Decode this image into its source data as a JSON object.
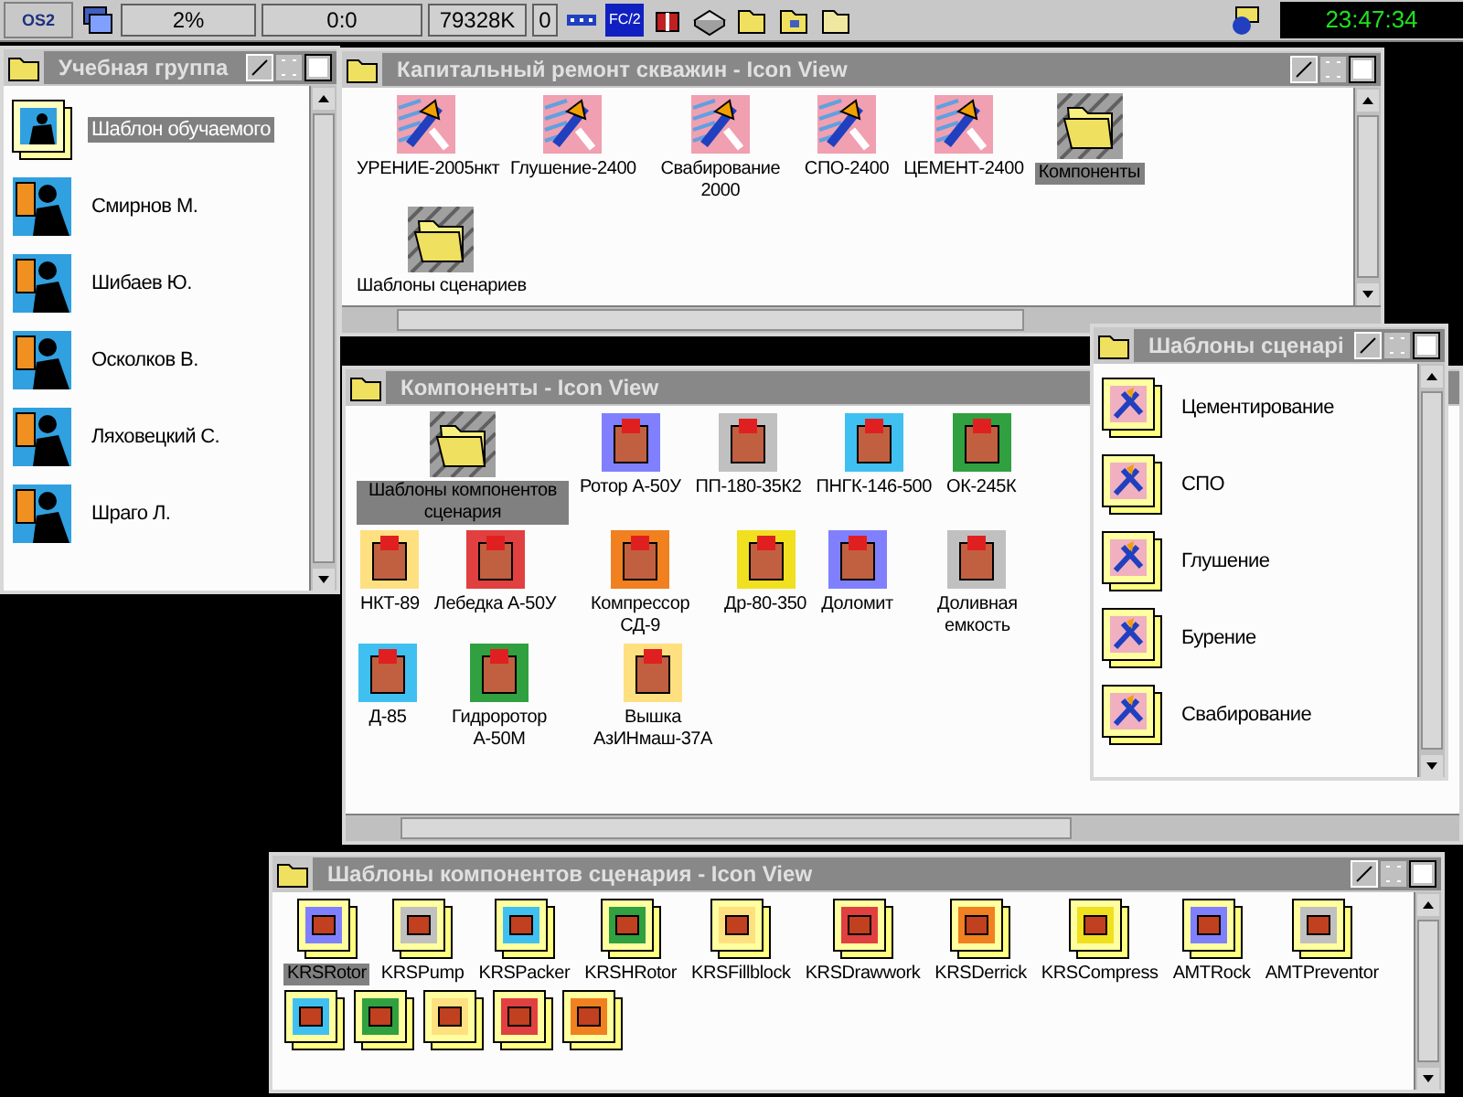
{
  "taskbar": {
    "logo": "OS2",
    "cpu": "2%",
    "uptime": "0:0",
    "memory": "79328K",
    "counter": "0",
    "fc_label": "FC/2",
    "clock": "23:47:34"
  },
  "windows": [
    {
      "title": "Учебная группа",
      "kind": "list",
      "items": [
        {
          "label": "Шаблон обучаемого",
          "selected": true,
          "kind": "person-template"
        },
        {
          "label": "Смирнов М.",
          "selected": false,
          "kind": "person"
        },
        {
          "label": "Шибаев Ю.",
          "selected": false,
          "kind": "person"
        },
        {
          "label": "Осколков В.",
          "selected": false,
          "kind": "person"
        },
        {
          "label": "Ляховецкий С.",
          "selected": false,
          "kind": "person"
        },
        {
          "label": "Шраго Л.",
          "selected": false,
          "kind": "person"
        }
      ]
    },
    {
      "title": "Капитальный ремонт скважин - Icon View",
      "kind": "icons",
      "items": [
        {
          "label": "УРЕНИЕ-2005нкт",
          "selected": false,
          "kind": "scenario"
        },
        {
          "label": "Глушение-2400",
          "selected": false,
          "kind": "scenario"
        },
        {
          "label": "Свабирование 2000",
          "selected": false,
          "kind": "scenario"
        },
        {
          "label": "СПО-2400",
          "selected": false,
          "kind": "scenario"
        },
        {
          "label": "ЦЕМЕНТ-2400",
          "selected": false,
          "kind": "scenario"
        },
        {
          "label": "Компоненты",
          "selected": true,
          "kind": "folder"
        },
        {
          "label": "Шаблоны сценариев",
          "selected": false,
          "kind": "folder"
        }
      ]
    },
    {
      "title": "Компоненты - Icon View",
      "kind": "icons",
      "items": [
        {
          "label": "Шаблоны компонентов сценария",
          "selected": true,
          "kind": "folder"
        },
        {
          "label": "Ротор А-50У",
          "selected": false,
          "kind": "component"
        },
        {
          "label": "ПП-180-35К2",
          "selected": false,
          "kind": "component"
        },
        {
          "label": "ПНГК-146-500",
          "selected": false,
          "kind": "component"
        },
        {
          "label": "ОК-245К",
          "selected": false,
          "kind": "component"
        },
        {
          "label": "НКТ-89",
          "selected": false,
          "kind": "component"
        },
        {
          "label": "Лебедка А-50У",
          "selected": false,
          "kind": "component"
        },
        {
          "label": "Компрессор СД-9",
          "selected": false,
          "kind": "component"
        },
        {
          "label": "Др-80-350",
          "selected": false,
          "kind": "component"
        },
        {
          "label": "Доломит",
          "selected": false,
          "kind": "component"
        },
        {
          "label": "Доливная емкость",
          "selected": false,
          "kind": "component"
        },
        {
          "label": "Д-85",
          "selected": false,
          "kind": "component"
        },
        {
          "label": "Гидроротор А-50М",
          "selected": false,
          "kind": "component"
        },
        {
          "label": "Вышка АзИНмаш-37А",
          "selected": false,
          "kind": "component"
        }
      ]
    },
    {
      "title": "Шаблоны сценарі",
      "kind": "list",
      "items": [
        {
          "label": "Цементирование",
          "selected": false,
          "kind": "scenario-template"
        },
        {
          "label": "СПО",
          "selected": false,
          "kind": "scenario-template"
        },
        {
          "label": "Глушение",
          "selected": false,
          "kind": "scenario-template"
        },
        {
          "label": "Бурение",
          "selected": false,
          "kind": "scenario-template"
        },
        {
          "label": "Свабирование",
          "selected": false,
          "kind": "scenario-template"
        }
      ]
    },
    {
      "title": "Шаблоны компонентов сценария - Icon View",
      "kind": "icons",
      "items": [
        {
          "label": "KRSRotor",
          "selected": true,
          "kind": "component-template"
        },
        {
          "label": "KRSPump",
          "selected": false,
          "kind": "component-template"
        },
        {
          "label": "KRSPacker",
          "selected": false,
          "kind": "component-template"
        },
        {
          "label": "KRSHRotor",
          "selected": false,
          "kind": "component-template"
        },
        {
          "label": "KRSFillblock",
          "selected": false,
          "kind": "component-template"
        },
        {
          "label": "KRSDrawwork",
          "selected": false,
          "kind": "component-template"
        },
        {
          "label": "KRSDerrick",
          "selected": false,
          "kind": "component-template"
        },
        {
          "label": "KRSCompress",
          "selected": false,
          "kind": "component-template"
        },
        {
          "label": "AMTRock",
          "selected": false,
          "kind": "component-template"
        },
        {
          "label": "AMTPreventor",
          "selected": false,
          "kind": "component-template"
        },
        {
          "selected": false,
          "kind": "component-template"
        },
        {
          "selected": false,
          "kind": "component-template"
        },
        {
          "selected": false,
          "kind": "component-template"
        },
        {
          "selected": false,
          "kind": "component-template"
        },
        {
          "selected": false,
          "kind": "component-template"
        }
      ]
    }
  ]
}
